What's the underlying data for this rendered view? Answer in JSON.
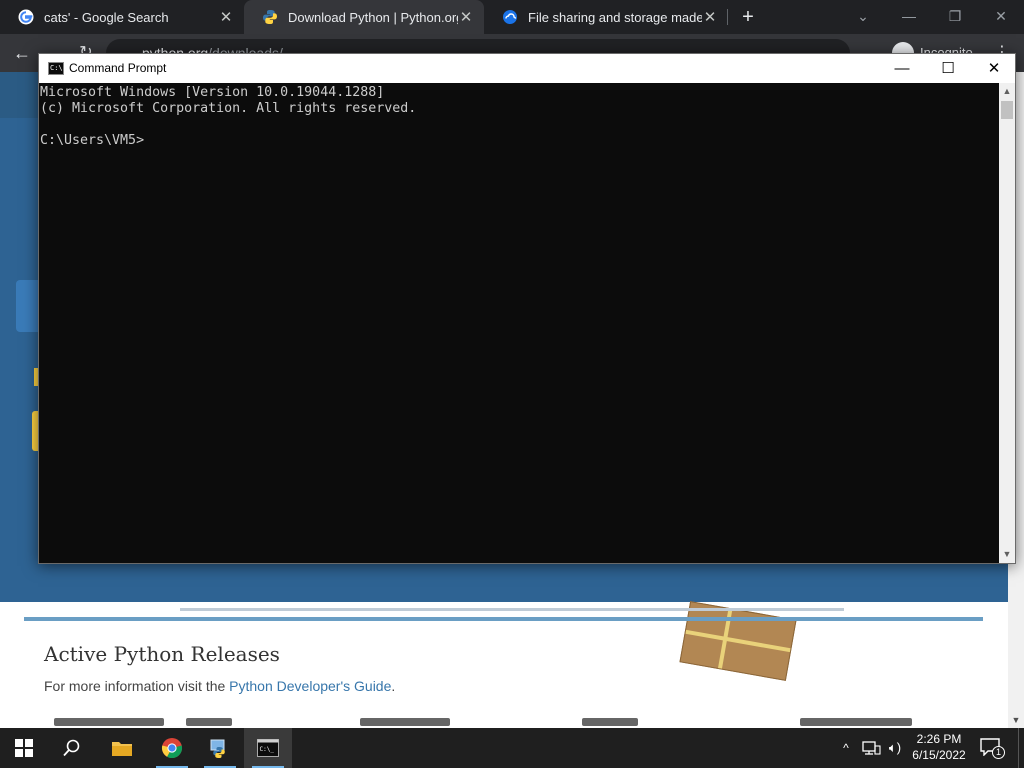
{
  "browser": {
    "tabs": [
      {
        "title": "cats' - Google Search",
        "favicon": "google-icon"
      },
      {
        "title": "Download Python | Python.org",
        "favicon": "python-icon"
      },
      {
        "title": "File sharing and storage made si",
        "favicon": "cloud-storage-icon"
      }
    ],
    "address": {
      "host": "python.org",
      "path": "/downloads/"
    },
    "profile_label": "Incognito"
  },
  "page": {
    "releases_title": "Active Python Releases",
    "releases_note_prefix": "For more information visit the ",
    "releases_note_link": "Python Developer's Guide",
    "releases_note_suffix": "."
  },
  "cmd": {
    "title": "Command Prompt",
    "lines": [
      "Microsoft Windows [Version 10.0.19044.1288]",
      "(c) Microsoft Corporation. All rights reserved.",
      "",
      "C:\\Users\\VM5>"
    ]
  },
  "taskbar": {
    "clock_time": "2:26 PM",
    "clock_date": "6/15/2022",
    "notification_count": "1"
  },
  "colors": {
    "cmd_background": "#0c0c0c",
    "cmd_text": "#cccccc",
    "python_blue": "#2e6393",
    "python_yellow": "#ffd343",
    "taskbar": "#1f1f1f"
  }
}
